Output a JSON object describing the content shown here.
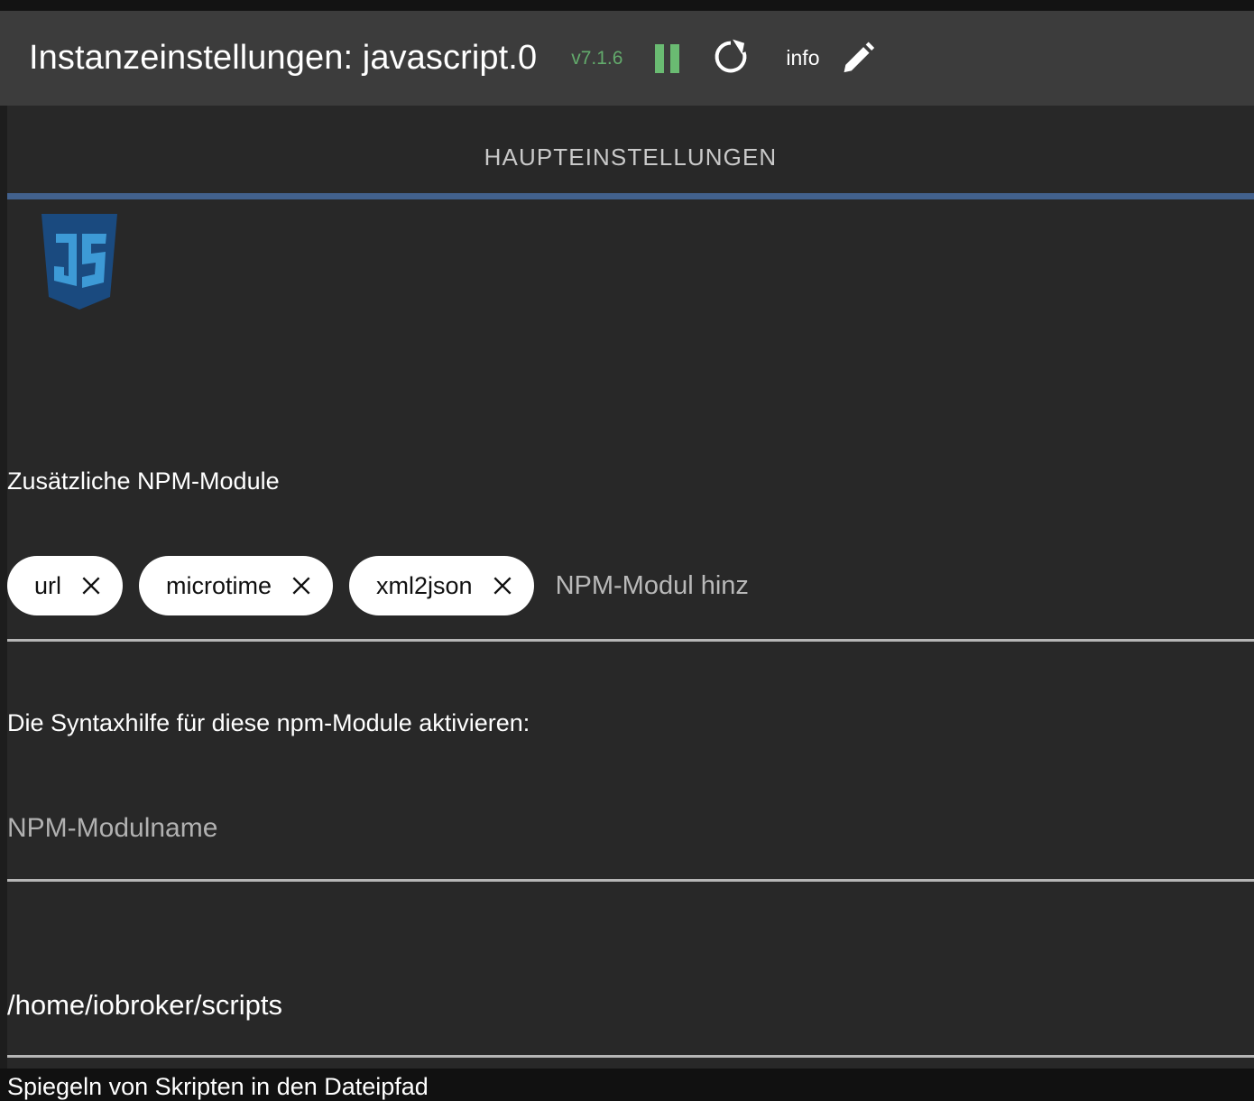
{
  "window": {
    "title": "Instanzeinstellungen: javascript.0",
    "version": "v7.1.6",
    "info_label": "info",
    "icons": {
      "pause": "pause-icon",
      "refresh": "refresh-icon",
      "edit": "pencil-icon"
    },
    "colors": {
      "header_bg": "#3c3c3c",
      "content_bg": "#282828",
      "version_green": "#63ab6c",
      "tab_underline_blue": "#42618d",
      "divider_gray": "#b6b6b6",
      "chip_bg": "#ffffff"
    }
  },
  "tabs": [
    {
      "label": "HAUPTEINSTELLUNGEN",
      "active": true
    }
  ],
  "adapter": {
    "logo_name": "javascript-logo",
    "logo_colors": {
      "shield": "#1a4a7f",
      "letters": "#3d9ad6"
    }
  },
  "settings": {
    "npm_modules": {
      "label": "Zusätzliche NPM-Module",
      "chips": [
        {
          "name": "url",
          "remove": "×"
        },
        {
          "name": "microtime",
          "remove": "×"
        },
        {
          "name": "xml2json",
          "remove": "×"
        }
      ],
      "input_placeholder": "NPM-Modul hinz"
    },
    "syntax_help": {
      "label": "Die Syntaxhilfe für diese npm-Module aktivieren:",
      "input_placeholder": "NPM-Modulname",
      "input_value": ""
    },
    "script_path": {
      "value": "/home/iobroker/scripts",
      "helper_label": "Spiegeln von Skripten in den Dateipfad"
    }
  }
}
